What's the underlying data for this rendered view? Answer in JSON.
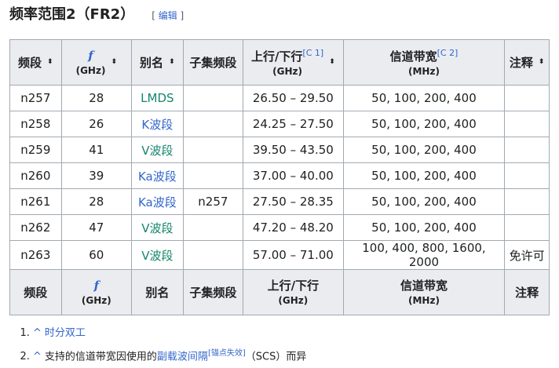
{
  "heading": {
    "title": "频率范围2（FR2）",
    "edit_open": "[ ",
    "edit_label": "编辑",
    "edit_close": " ]"
  },
  "columns": {
    "band": "频段",
    "freq_symbol": "f",
    "freq_unit": "(GHz)",
    "alias": "别名",
    "subset": "子集频段",
    "ul_dl": "上行/下行",
    "ul_dl_ref": "[C 1]",
    "ul_dl_unit": "(GHz)",
    "bw": "信道带宽",
    "bw_ref": "[C 2]",
    "bw_unit": "(MHz)",
    "notes": "注释"
  },
  "sort_icon": "⬍",
  "rows": [
    {
      "band": "n257",
      "f": "28",
      "alias": "LMDS",
      "alias_color": "green",
      "subset": "",
      "uldl": "26.50 – 29.50",
      "bw": "50, 100, 200, 400",
      "notes": ""
    },
    {
      "band": "n258",
      "f": "26",
      "alias": "K波段",
      "alias_color": "blue",
      "subset": "",
      "uldl": "24.25 – 27.50",
      "bw": "50, 100, 200, 400",
      "notes": ""
    },
    {
      "band": "n259",
      "f": "41",
      "alias": "V波段",
      "alias_color": "green",
      "subset": "",
      "uldl": "39.50 – 43.50",
      "bw": "50, 100, 200, 400",
      "notes": ""
    },
    {
      "band": "n260",
      "f": "39",
      "alias": "Ka波段",
      "alias_color": "blue",
      "subset": "",
      "uldl": "37.00 – 40.00",
      "bw": "50, 100, 200, 400",
      "notes": ""
    },
    {
      "band": "n261",
      "f": "28",
      "alias": "Ka波段",
      "alias_color": "blue",
      "subset": "n257",
      "uldl": "27.50 – 28.35",
      "bw": "50, 100, 200, 400",
      "notes": ""
    },
    {
      "band": "n262",
      "f": "47",
      "alias": "V波段",
      "alias_color": "green",
      "subset": "",
      "uldl": "47.20 – 48.20",
      "bw": "50, 100, 200, 400",
      "notes": ""
    },
    {
      "band": "n263",
      "f": "60",
      "alias": "V波段",
      "alias_color": "green",
      "subset": "",
      "uldl": "57.00 – 71.00",
      "bw": "100, 400, 800, 1600, 2000",
      "notes": "免许可"
    }
  ],
  "footnotes": [
    {
      "caret": "^",
      "text": "时分双工",
      "link": true
    },
    {
      "caret": "^",
      "before": "支持的信道带宽因使用的",
      "link_text": "副载波间隔",
      "sup": "[锚点失效]",
      "after": "（SCS）而异"
    }
  ],
  "colors": {
    "link": "#3366cc",
    "green_link": "#14866d",
    "header_bg": "#eaecf0",
    "border": "#a2a9b1"
  }
}
